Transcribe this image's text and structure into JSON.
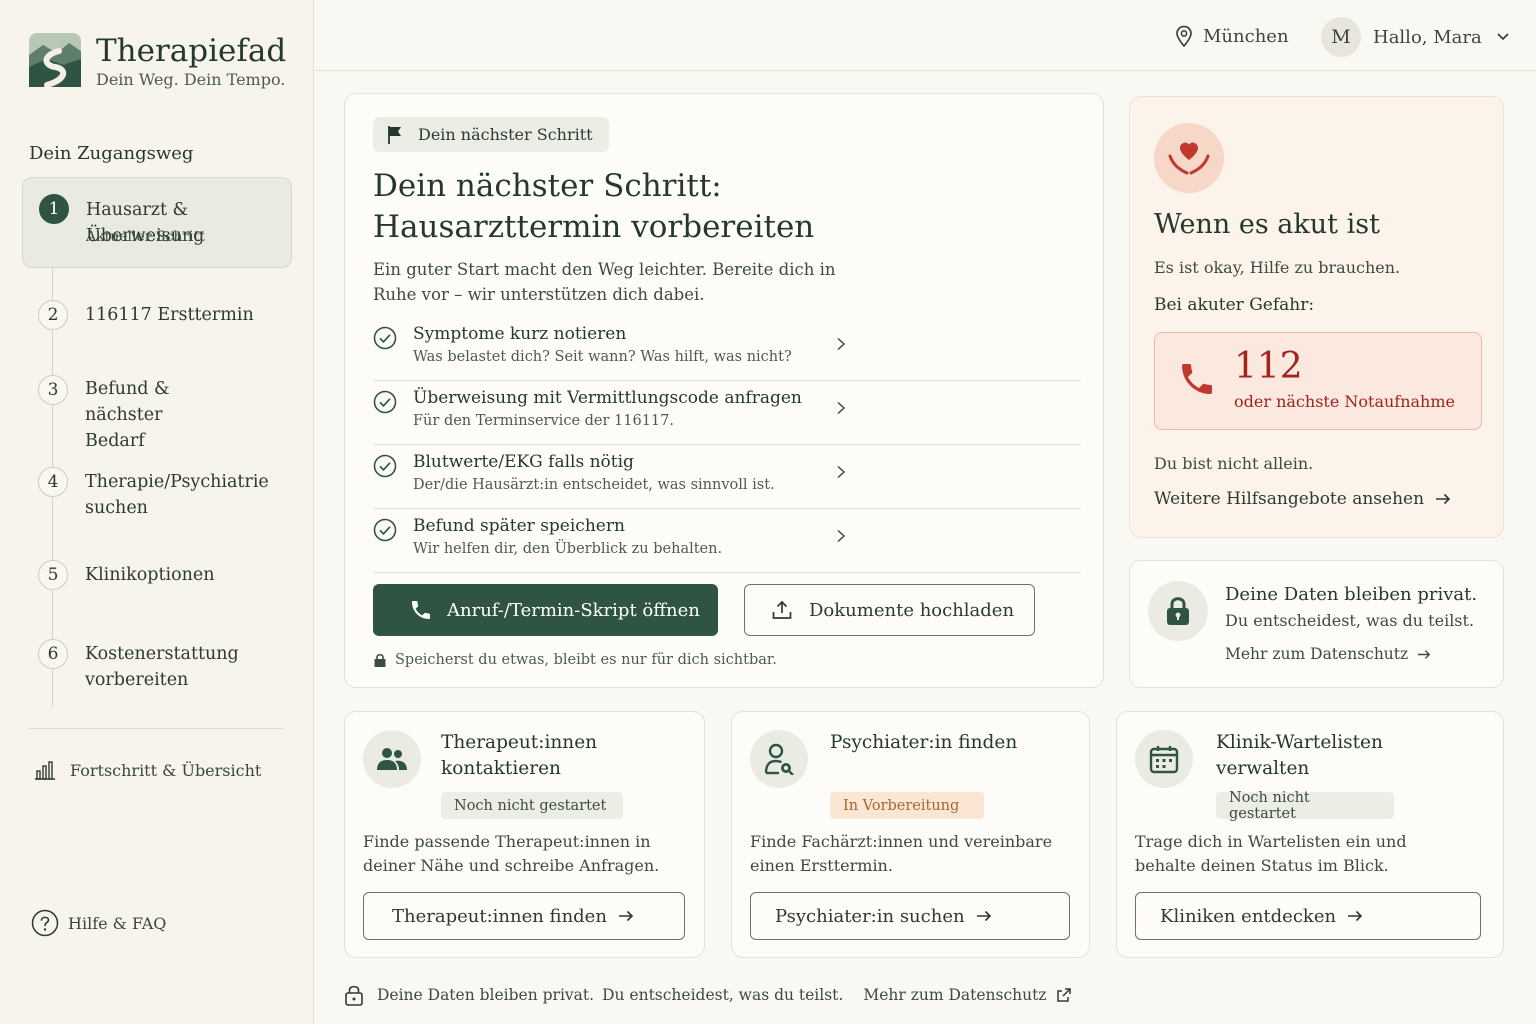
{
  "brand": {
    "name": "Therapiefad",
    "tagline": "Dein Weg. Dein Tempo."
  },
  "sidebar": {
    "heading": "Dein Zugangsweg",
    "steps": [
      {
        "num": "1",
        "label": "Hausarzt & Überweisung",
        "sub": "Aktueller Schritt"
      },
      {
        "num": "2",
        "label": "116117 Ersttermin"
      },
      {
        "num": "3",
        "label": "Befund & nächster Bedarf"
      },
      {
        "num": "4",
        "label": "Therapie/Psychiatrie suchen"
      },
      {
        "num": "5",
        "label": "Klinikoptionen"
      },
      {
        "num": "6",
        "label": "Kostenerstattung vorbereiten"
      }
    ],
    "progress_link": "Fortschritt & Übersicht",
    "help_link": "Hilfe & FAQ"
  },
  "topbar": {
    "location": "München",
    "avatar_initial": "M",
    "greeting": "Hallo, Mara"
  },
  "main": {
    "pill": "Dein nächster Schritt",
    "title": "Dein nächster Schritt: Hausarzttermin vorbereiten",
    "description": "Ein guter Start macht den Weg leichter. Bereite dich in Ruhe vor – wir unterstützen dich dabei.",
    "checklist": [
      {
        "title": "Symptome kurz notieren",
        "sub": "Was belastet dich? Seit wann? Was hilft, was nicht?"
      },
      {
        "title": "Überweisung mit Vermittlungscode anfragen",
        "sub": "Für den Terminservice der 116117."
      },
      {
        "title": "Blutwerte/EKG falls nötig",
        "sub": "Der/die Hausärzt:in entscheidet, was sinnvoll ist."
      },
      {
        "title": "Befund später speichern",
        "sub": "Wir helfen dir, den Überblick zu behalten."
      }
    ],
    "primary_button": "Anruf-/Termin-Skript öffnen",
    "secondary_button": "Dokumente hochladen",
    "note": "Speicherst du etwas, bleibt es nur für dich sichtbar."
  },
  "emergency": {
    "title": "Wenn es akut ist",
    "text1": "Es ist okay, Hilfe zu brauchen.",
    "text2": "Bei akuter Gefahr:",
    "number": "112",
    "number_sub": "oder nächste Notaufnahme",
    "text3": "Du bist nicht allein.",
    "link": "Weitere Hilfsangebote ansehen"
  },
  "privacy": {
    "title": "Deine Daten bleiben privat.",
    "sub": "Du entscheidest, was du teilst.",
    "link": "Mehr zum Datenschutz"
  },
  "services": [
    {
      "title": "Therapeut:innen kontaktieren",
      "status": "Noch nicht gestartet",
      "desc": "Finde passende Therapeut:innen in deiner Nähe und schreibe Anfragen.",
      "button": "Therapeut:innen finden"
    },
    {
      "title": "Psychiater:in finden",
      "status": "In Vorbereitung",
      "desc": "Finde Fachärzt:innen und vereinbare einen Ersttermin.",
      "button": "Psychiater:in suchen"
    },
    {
      "title": "Klinik-Wartelisten verwalten",
      "status": "Noch nicht gestartet",
      "desc": "Trage dich in Wartelisten ein und behalte deinen Status im Blick.",
      "button": "Kliniken entdecken"
    }
  ],
  "footer": {
    "text1": "Deine Daten bleiben privat.",
    "text2": "Du entscheidest, was du teilst.",
    "link": "Mehr zum Datenschutz"
  },
  "colors": {
    "primary": "#2f5443",
    "emergency": "#a2241c",
    "background": "#faf8f2",
    "warning": "#a7672c"
  }
}
